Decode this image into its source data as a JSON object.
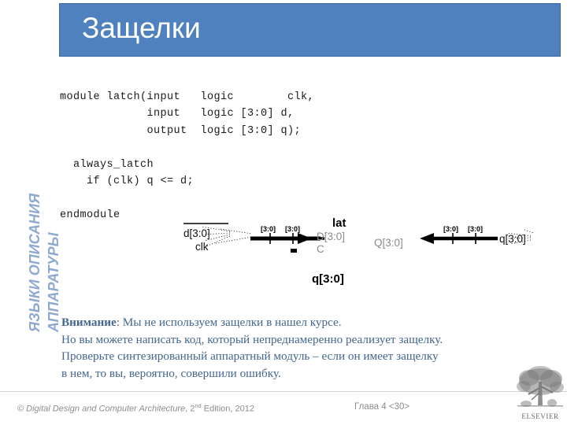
{
  "slide": {
    "title": "Защелки",
    "title_bar_color": "#4e81bd",
    "title_text_color": "#ffffff"
  },
  "sidebar": {
    "line1": "ЯЗЫКИ ОПИСАНИЯ",
    "line2": "АППАРАТУРЫ",
    "color": "#8fa8cf"
  },
  "code": {
    "language": "SystemVerilog",
    "text": "module latch(input   logic        clk,\n             input   logic [3:0] d,\n             output  logic [3:0] q);\n\n  always_latch\n    if (clk) q <= d;\n\nendmodule",
    "color": "#1a1a1a"
  },
  "diagram": {
    "title": "latch schematic",
    "component_label": "lat",
    "input_d_label": "d[3:0]",
    "input_clk_label": "clk",
    "port_d_label": "D[3:0]",
    "port_c_label": "C",
    "port_q_label": "Q[3:0]",
    "output_q_label": "q[3:0]",
    "output_bottom_label": "q[3:0]",
    "bus_width_label_1": "[3:0]",
    "bus_width_label_2": "[3:0]",
    "bus_width_label_3": "[3:0]",
    "bus_width_label_4": "[3:0]"
  },
  "note": {
    "emphasis": "Внимание",
    "line1_rest": ": Мы не используем защелки в нашел курсе.",
    "line2": "Но вы можете написать код, который непреднамеренно реализует защелку.",
    "line3": "Проверьте синтезированный аппаратный модуль – если он имеет защелку",
    "line4": "в нем, то вы, вероятно, совершили  ошибку.",
    "color": "#44668f"
  },
  "footer": {
    "copyright_symbol": "©",
    "book_title": "Digital Design and Computer Architecture",
    "edition_prefix": ", 2",
    "edition_sup": "nd",
    "edition_suffix": " Edition, 2012",
    "chapter": "Глава 4 <30>",
    "publisher": "ELSEVIER",
    "color": "#8c8c8c"
  }
}
